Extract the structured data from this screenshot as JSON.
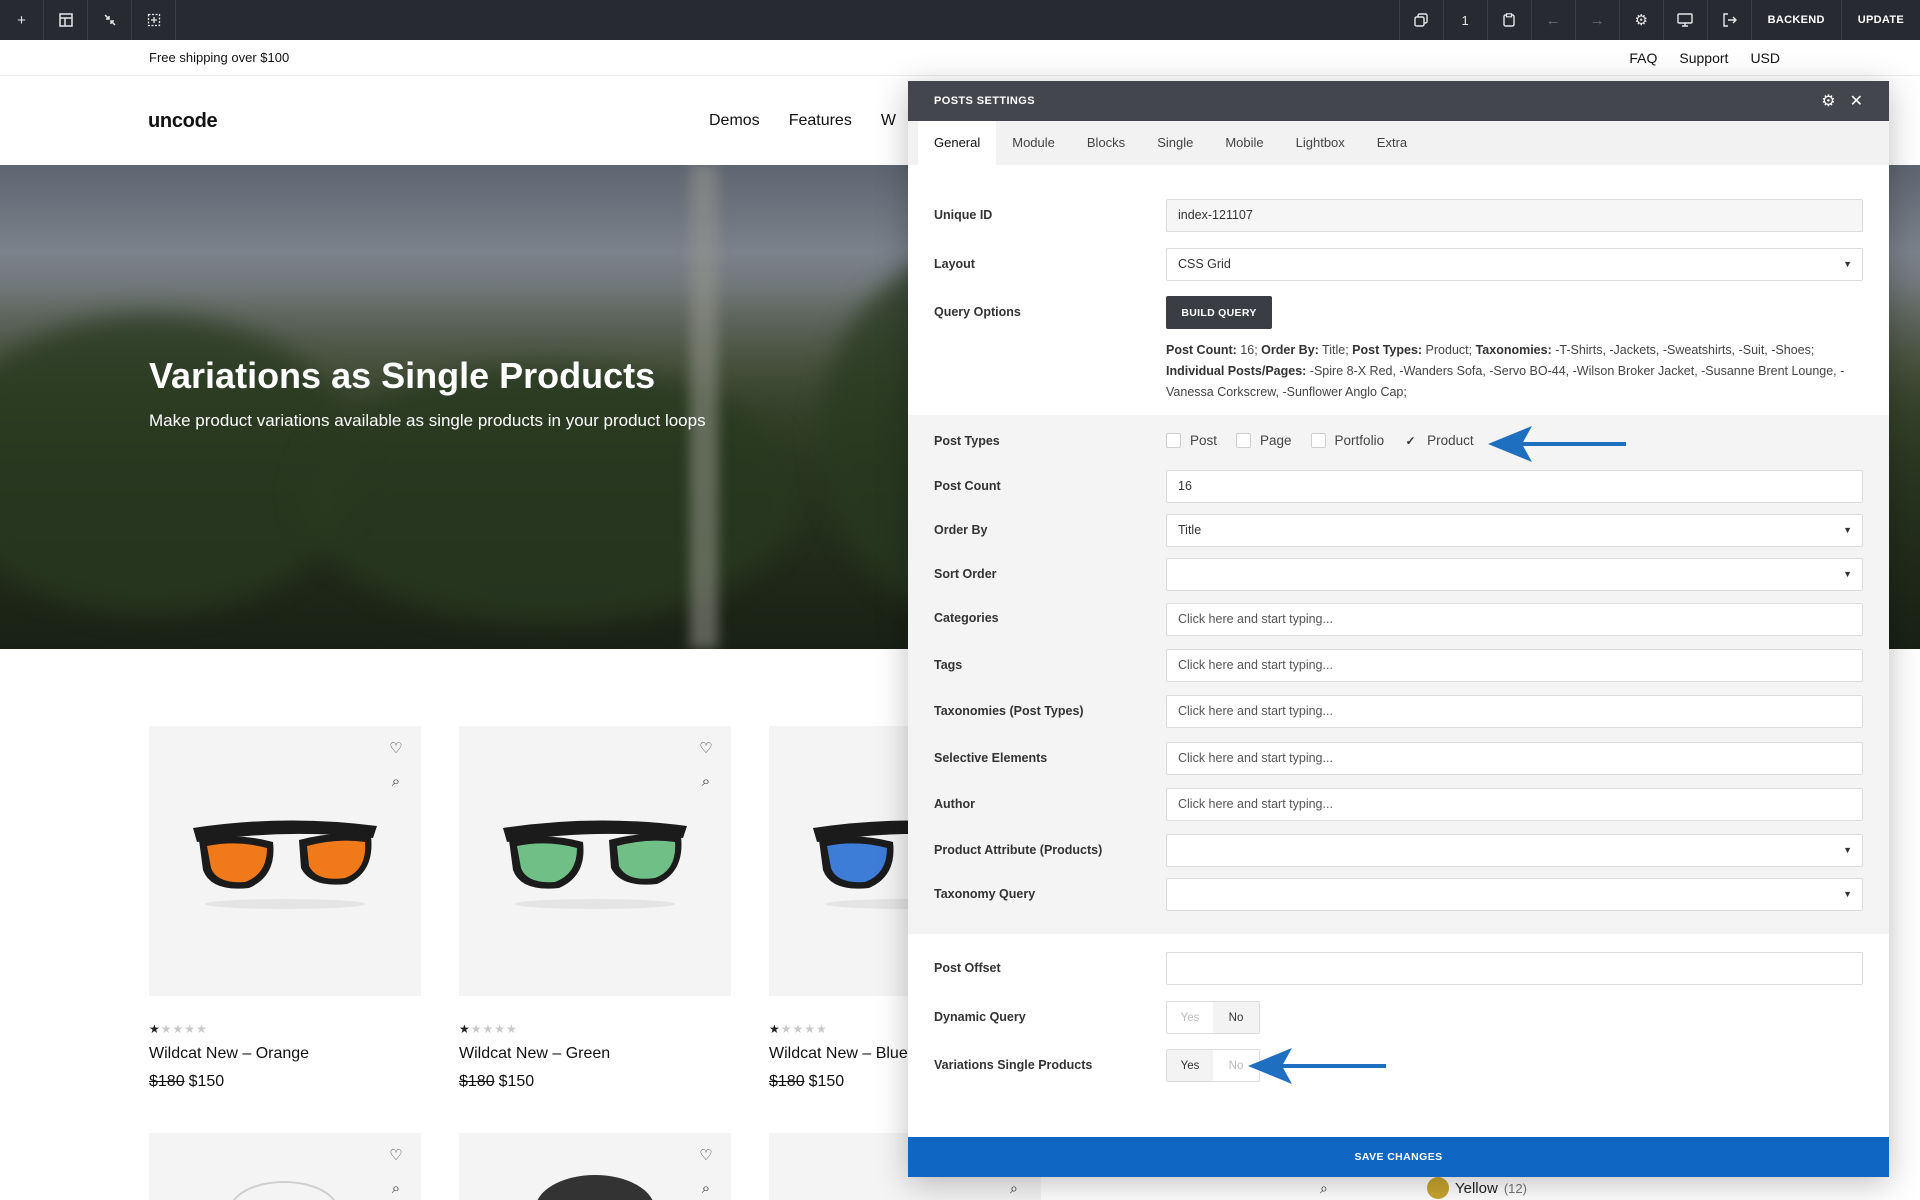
{
  "builder": {
    "page_number": "1",
    "backend_label": "BACKEND",
    "update_label": "UPDATE"
  },
  "site": {
    "shipping_notice": "Free shipping over $100",
    "top_links": [
      "FAQ",
      "Support",
      "USD"
    ],
    "logo": "uncode",
    "nav": [
      "Demos",
      "Features",
      "W"
    ],
    "hero_title": "Variations as Single Products",
    "hero_subtitle": "Make product variations available as single products in your product loops"
  },
  "products": [
    {
      "name": "Wildcat New – Orange",
      "old_price": "$180",
      "price": "$150",
      "lens_color": "#f07a1a"
    },
    {
      "name": "Wildcat New – Green",
      "old_price": "$180",
      "price": "$150",
      "lens_color": "#6fbf87"
    },
    {
      "name": "Wildcat New – Blue",
      "old_price": "$180",
      "price": "$150",
      "lens_color": "#3d7dd8"
    }
  ],
  "swatch": {
    "label": "Yellow",
    "count": "(12)"
  },
  "modal": {
    "title": "POSTS SETTINGS",
    "tabs": [
      "General",
      "Module",
      "Blocks",
      "Single",
      "Mobile",
      "Lightbox",
      "Extra"
    ],
    "fields": {
      "unique_id": {
        "label": "Unique ID",
        "value": "index-121107"
      },
      "layout": {
        "label": "Layout",
        "value": "CSS Grid"
      },
      "query_options": {
        "label": "Query Options",
        "button": "BUILD QUERY"
      },
      "post_types": {
        "label": "Post Types",
        "options": [
          "Post",
          "Page",
          "Portfolio",
          "Product"
        ],
        "checked": "Product"
      },
      "post_count": {
        "label": "Post Count",
        "value": "16"
      },
      "order_by": {
        "label": "Order By",
        "value": "Title"
      },
      "sort_order": {
        "label": "Sort Order",
        "value": ""
      },
      "categories": {
        "label": "Categories",
        "placeholder": "Click here and start typing..."
      },
      "tags": {
        "label": "Tags",
        "placeholder": "Click here and start typing..."
      },
      "taxonomies": {
        "label": "Taxonomies (Post Types)",
        "placeholder": "Click here and start typing..."
      },
      "selective_elements": {
        "label": "Selective Elements",
        "placeholder": "Click here and start typing..."
      },
      "author": {
        "label": "Author",
        "placeholder": "Click here and start typing..."
      },
      "product_attribute": {
        "label": "Product Attribute (Products)",
        "value": ""
      },
      "taxonomy_query": {
        "label": "Taxonomy Query",
        "value": ""
      },
      "post_offset": {
        "label": "Post Offset",
        "value": ""
      },
      "dynamic_query": {
        "label": "Dynamic Query",
        "yes": "Yes",
        "no": "No",
        "selected": "No"
      },
      "variations_single": {
        "label": "Variations Single Products",
        "yes": "Yes",
        "no": "No",
        "selected": "Yes"
      }
    },
    "query_summary": {
      "k1": "Post Count:",
      "v1": " 16; ",
      "k2": "Order By:",
      "v2": " Title; ",
      "k3": "Post Types:",
      "v3": " Product; ",
      "k4": "Taxonomies:",
      "v4": " -T-Shirts, -Jackets, -Sweatshirts, -Suit, -Shoes; ",
      "k5": "Individual Posts/Pages:",
      "v5": " -Spire 8-X Red, -Wanders Sofa, -Servo BO-44, -Wilson Broker Jacket, -Susanne Brent Lounge, -Vanessa Corkscrew, -Sunflower Anglo Cap;"
    },
    "save_label": "SAVE CHANGES"
  },
  "colors": {
    "toolbar_bg": "#272a31",
    "modal_header_bg": "#43464c",
    "save_bar": "#0f66c3",
    "arrow": "#1f6fc0"
  }
}
